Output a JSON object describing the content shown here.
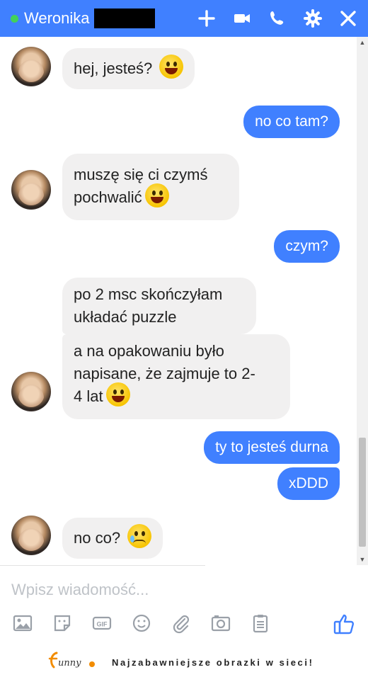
{
  "header": {
    "contact_name": "Weronika",
    "icons": [
      "plus-icon",
      "video-icon",
      "phone-icon",
      "gear-icon",
      "close-icon"
    ],
    "accent_color": "#4080ff",
    "online_color": "#42d15a"
  },
  "messages": [
    {
      "sender": "contact",
      "text": "hej, jesteś?",
      "emoji": "grinning-face"
    },
    {
      "sender": "me",
      "text": "no co tam?"
    },
    {
      "sender": "contact",
      "text_line1": "muszę się ci czymś",
      "text_line2": "pochwalić",
      "emoji": "grinning-face"
    },
    {
      "sender": "me",
      "text": "czym?"
    },
    {
      "sender": "contact",
      "text_line1": "po 2 msc skończyłam",
      "text_line2": "układać puzzle"
    },
    {
      "sender": "contact",
      "text_line1": "a na opakowaniu było",
      "text_line2": "napisane, że zajmuje to 2-",
      "text_line3": "4 lat",
      "emoji": "grinning-face"
    },
    {
      "sender": "me",
      "text": "ty to jesteś durna"
    },
    {
      "sender": "me",
      "text": "xDDD"
    },
    {
      "sender": "contact",
      "text": "no co?",
      "emoji": "sad-sweat-face"
    }
  ],
  "composer": {
    "placeholder": "Wpisz wiadomość...",
    "tools": [
      "image-icon",
      "sticker-icon",
      "gif-icon",
      "emoji-icon",
      "attach-icon",
      "camera-icon",
      "clipboard-icon"
    ],
    "like_icon": "thumbs-up-icon"
  },
  "footer": {
    "logo_text": "funny",
    "slogan": "Najzabawniejsze obrazki w sieci!"
  }
}
